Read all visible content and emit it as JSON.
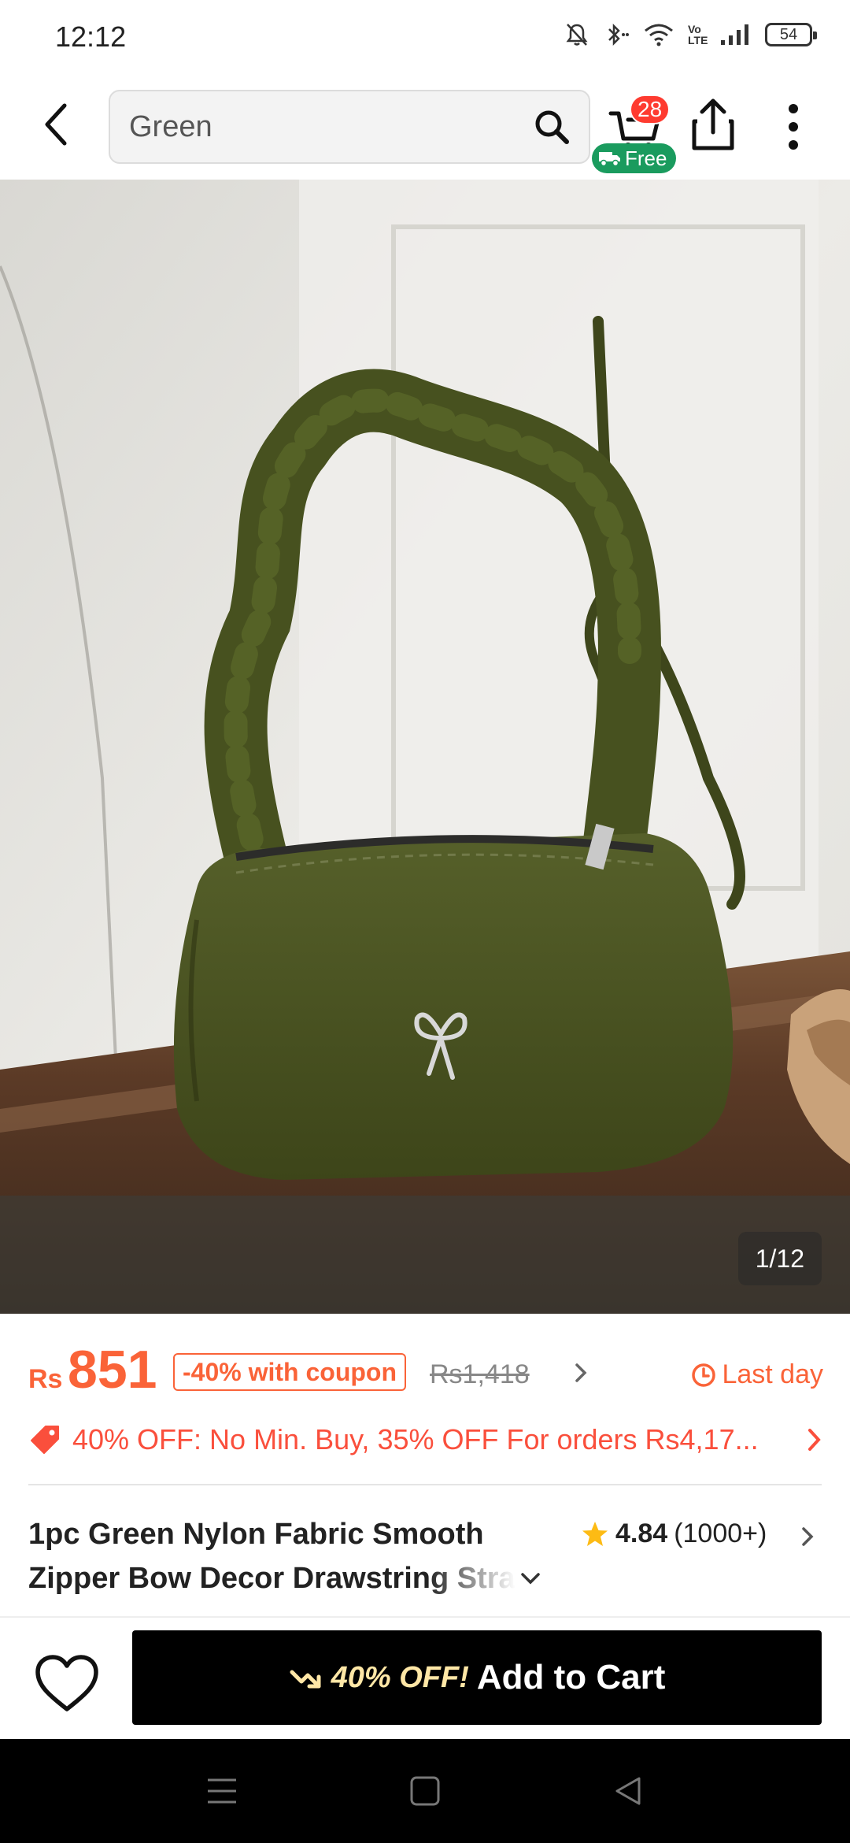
{
  "status_bar": {
    "time": "12:12",
    "battery": "54",
    "network": "Vo LTE"
  },
  "header": {
    "search_value": "Green",
    "cart_count": "28",
    "free_shipping_label": "Free"
  },
  "gallery": {
    "counter": "1/12",
    "product_color": "#4a5320"
  },
  "pricing": {
    "currency": "Rs",
    "price": "851",
    "coupon": "-40% with coupon",
    "original_price": "Rs1,418",
    "deadline": "Last day",
    "promo": "40% OFF: No Min. Buy,  35% OFF For orders Rs4,17...",
    "accent_color": "#fa6338"
  },
  "product": {
    "title_line1": "1pc Green Nylon Fabric Smooth",
    "title_line2": "Zipper Bow Decor Drawstring Stra",
    "rating": "4.84",
    "review_count": "(1000+)"
  },
  "action_bar": {
    "discount": "40% OFF!",
    "add_to_cart": "Add to Cart"
  },
  "icons": {
    "back": "back-arrow-icon",
    "search": "search-icon",
    "cart": "cart-icon",
    "share": "share-icon",
    "more": "more-vertical-icon",
    "wishlist": "heart-icon",
    "star": "star-icon",
    "clock": "clock-icon",
    "tag": "tag-icon"
  }
}
